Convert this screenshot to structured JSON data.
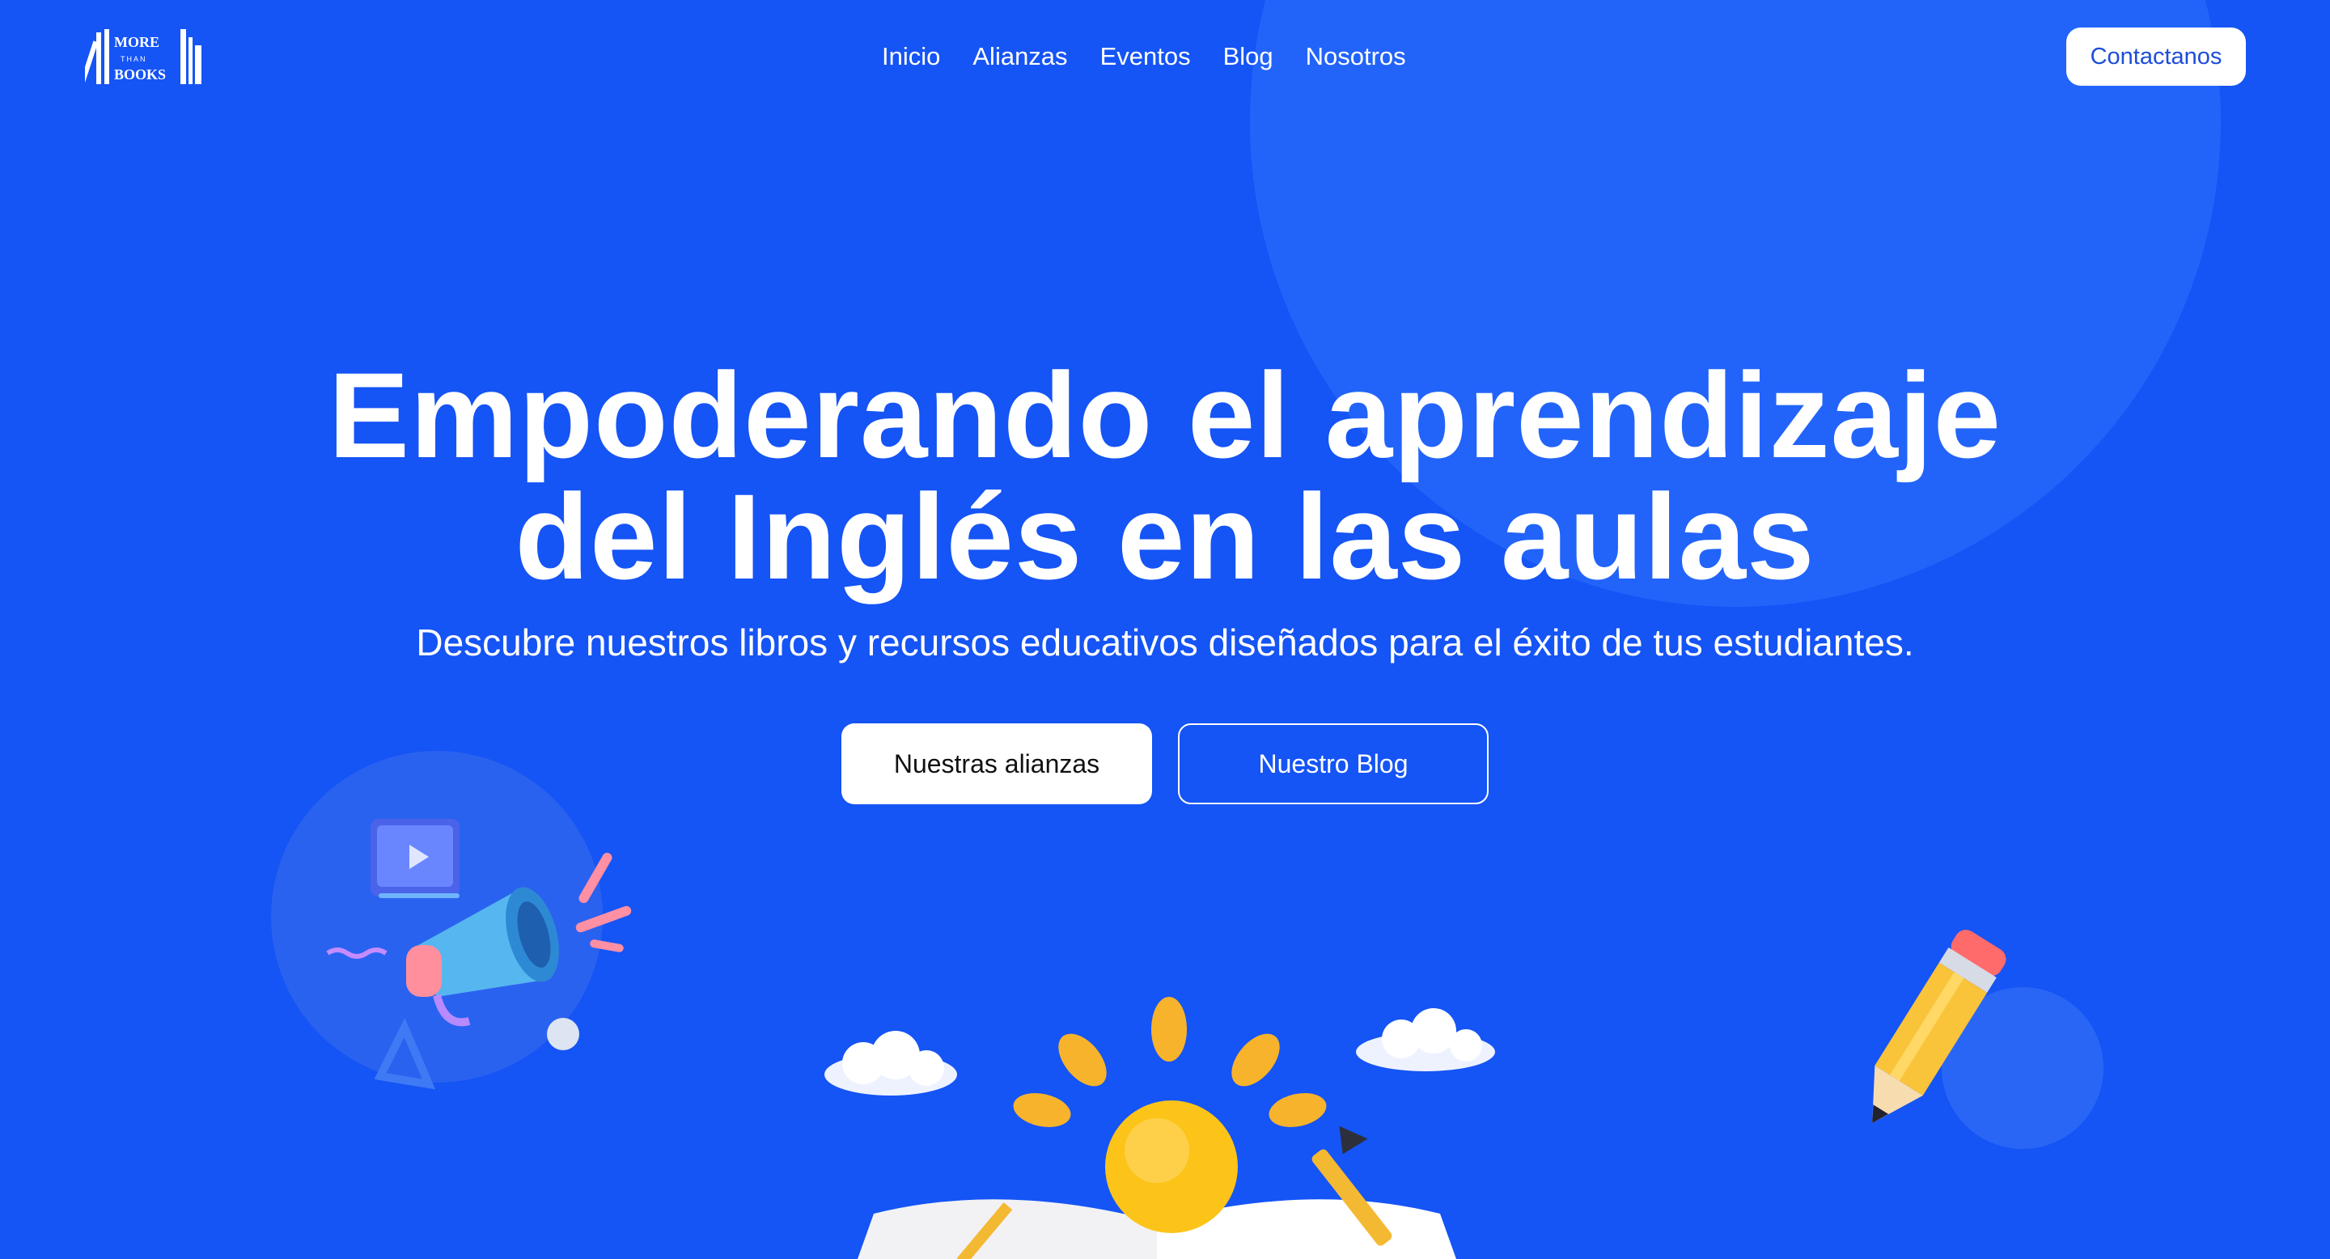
{
  "header": {
    "logo_text": [
      "MORE",
      "THAN",
      "BOOKS"
    ],
    "nav": [
      "Inicio",
      "Alianzas",
      "Eventos",
      "Blog",
      "Nosotros"
    ],
    "contact_label": "Contactanos"
  },
  "hero": {
    "title_line1": "Empoderando el aprendizaje",
    "title_line2": "del Inglés en las aulas",
    "subtitle": "Descubre nuestros libros y recursos educativos diseñados para el éxito de tus estudiantes.",
    "primary_label": "Nuestras alianzas",
    "secondary_label": "Nuestro Blog"
  },
  "colors": {
    "background": "#1554f5",
    "accent": "#ffffff",
    "contact_text": "#1d4ed8"
  },
  "icons": [
    "megaphone-icon",
    "video-play-icon",
    "lightbulb-icon",
    "cloud-icon",
    "pencil-icon",
    "pen-nib-icon",
    "open-book-icon"
  ]
}
